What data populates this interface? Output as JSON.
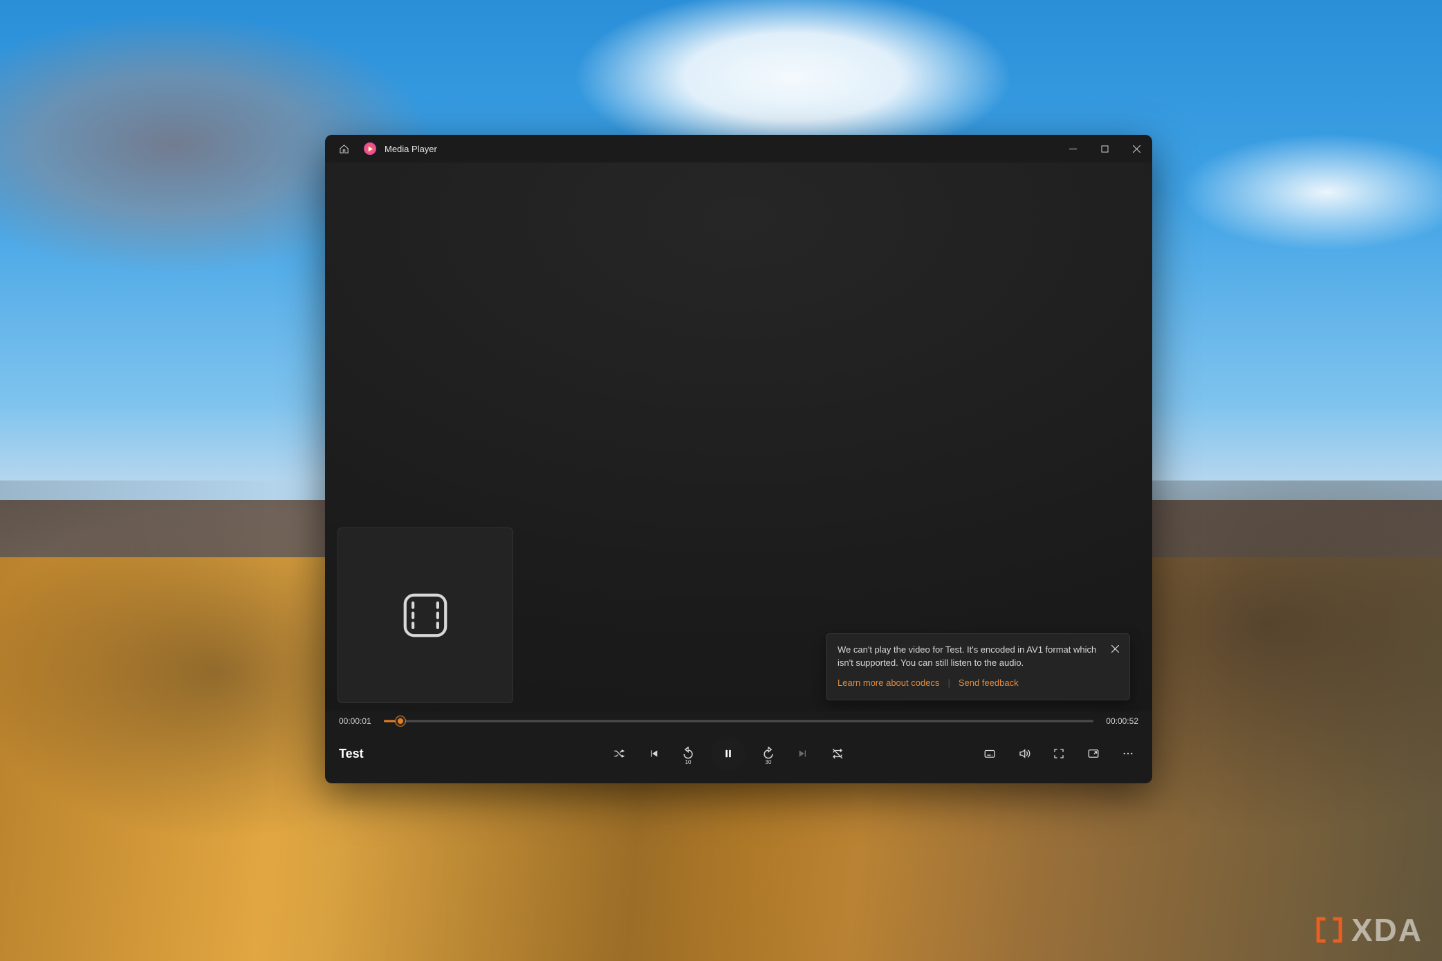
{
  "titlebar": {
    "app_name": "Media Player"
  },
  "media": {
    "title": "Test",
    "elapsed": "00:00:01",
    "duration": "00:00:52",
    "progress_percent": 2.4
  },
  "toast": {
    "message": "We can't play the video for Test. It's encoded in AV1 format which isn't supported. You can still listen to the audio.",
    "learn_more": "Learn more about codecs",
    "feedback": "Send feedback"
  },
  "controls": {
    "skip_back_seconds": "10",
    "skip_forward_seconds": "30"
  },
  "watermark": {
    "text": "XDA"
  },
  "colors": {
    "accent": "#e67e22",
    "link": "#e38b3c"
  }
}
